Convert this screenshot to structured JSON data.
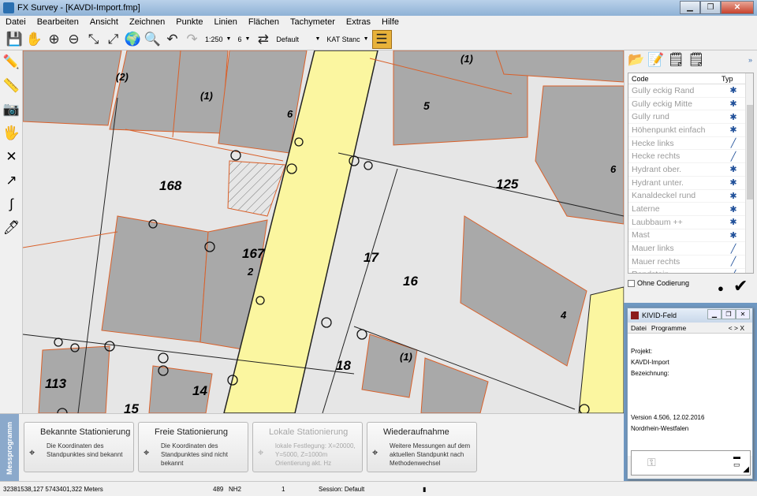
{
  "title": "FX Survey - [KAVDI-Import.fmp]",
  "menu": [
    "Datei",
    "Bearbeiten",
    "Ansicht",
    "Zeichnen",
    "Punkte",
    "Linien",
    "Flächen",
    "Tachymeter",
    "Extras",
    "Hilfe"
  ],
  "toolbar": {
    "scale": "1:250",
    "size": "6",
    "layer": "Default",
    "kat": "KAT Stanc"
  },
  "right_panel": {
    "header_code": "Code",
    "header_typ": "Typ",
    "more": "»",
    "codes": [
      {
        "label": "Gully eckig Rand",
        "sym": "✱"
      },
      {
        "label": "Gully eckig Mitte",
        "sym": "✱"
      },
      {
        "label": "Gully rund",
        "sym": "✱"
      },
      {
        "label": "Höhenpunkt einfach",
        "sym": "✱"
      },
      {
        "label": "Hecke links",
        "sym": "╱"
      },
      {
        "label": "Hecke rechts",
        "sym": "╱"
      },
      {
        "label": "Hydrant ober.",
        "sym": "✱"
      },
      {
        "label": "Hydrant unter.",
        "sym": "✱"
      },
      {
        "label": "Kanaldeckel rund",
        "sym": "✱"
      },
      {
        "label": "Laterne",
        "sym": "✱"
      },
      {
        "label": "Laubbaum ++",
        "sym": "✱"
      },
      {
        "label": "Mast",
        "sym": "✱"
      },
      {
        "label": "Mauer links",
        "sym": "╱"
      },
      {
        "label": "Mauer rechts",
        "sym": "╱"
      },
      {
        "label": "Randstein",
        "sym": "╱"
      }
    ],
    "ohne": "Ohne Codierung"
  },
  "kivid": {
    "title": "KIVID-Feld",
    "menu1": "Datei",
    "menu2": "Programme",
    "nav": "<  >  X",
    "projekt": "Projekt:",
    "projekt_val": "KAVDI-Import",
    "bez": "Bezeichnung:",
    "version": "Version 4.506, 12.02.2016",
    "land": "Nordrhein-Westfalen"
  },
  "messprogramm": "Messprogramm",
  "station_buttons": [
    {
      "title": "Bekannte Stationierung",
      "desc": "Die Koordinaten des Standpunktes sind bekannt",
      "disabled": false
    },
    {
      "title": "Freie Stationierung",
      "desc": "Die Koordinaten des Standpunktes sind nicht bekannt",
      "disabled": false
    },
    {
      "title": "Lokale Stationierung",
      "desc": "lokale Festlegung: X=20000, Y=5000, Z=1000m Orientierung akt. Hz",
      "disabled": true
    },
    {
      "title": "Wiederaufnahme",
      "desc": "Weitere Messungen auf dem aktuellen Standpunkt nach Methodenwechsel",
      "disabled": false
    }
  ],
  "status": {
    "coords": "32381538,127 5743401,322 Meters",
    "n1": "489",
    "nh": "NH2",
    "n2": "1",
    "session": "Session: Default"
  },
  "map": {
    "parcels": [
      "168",
      "167",
      "125",
      "17",
      "16",
      "18",
      "113",
      "14",
      "15",
      "5",
      "(2)",
      "(1)",
      "6",
      "2",
      "4",
      "(1)",
      "6",
      "(1)"
    ]
  }
}
